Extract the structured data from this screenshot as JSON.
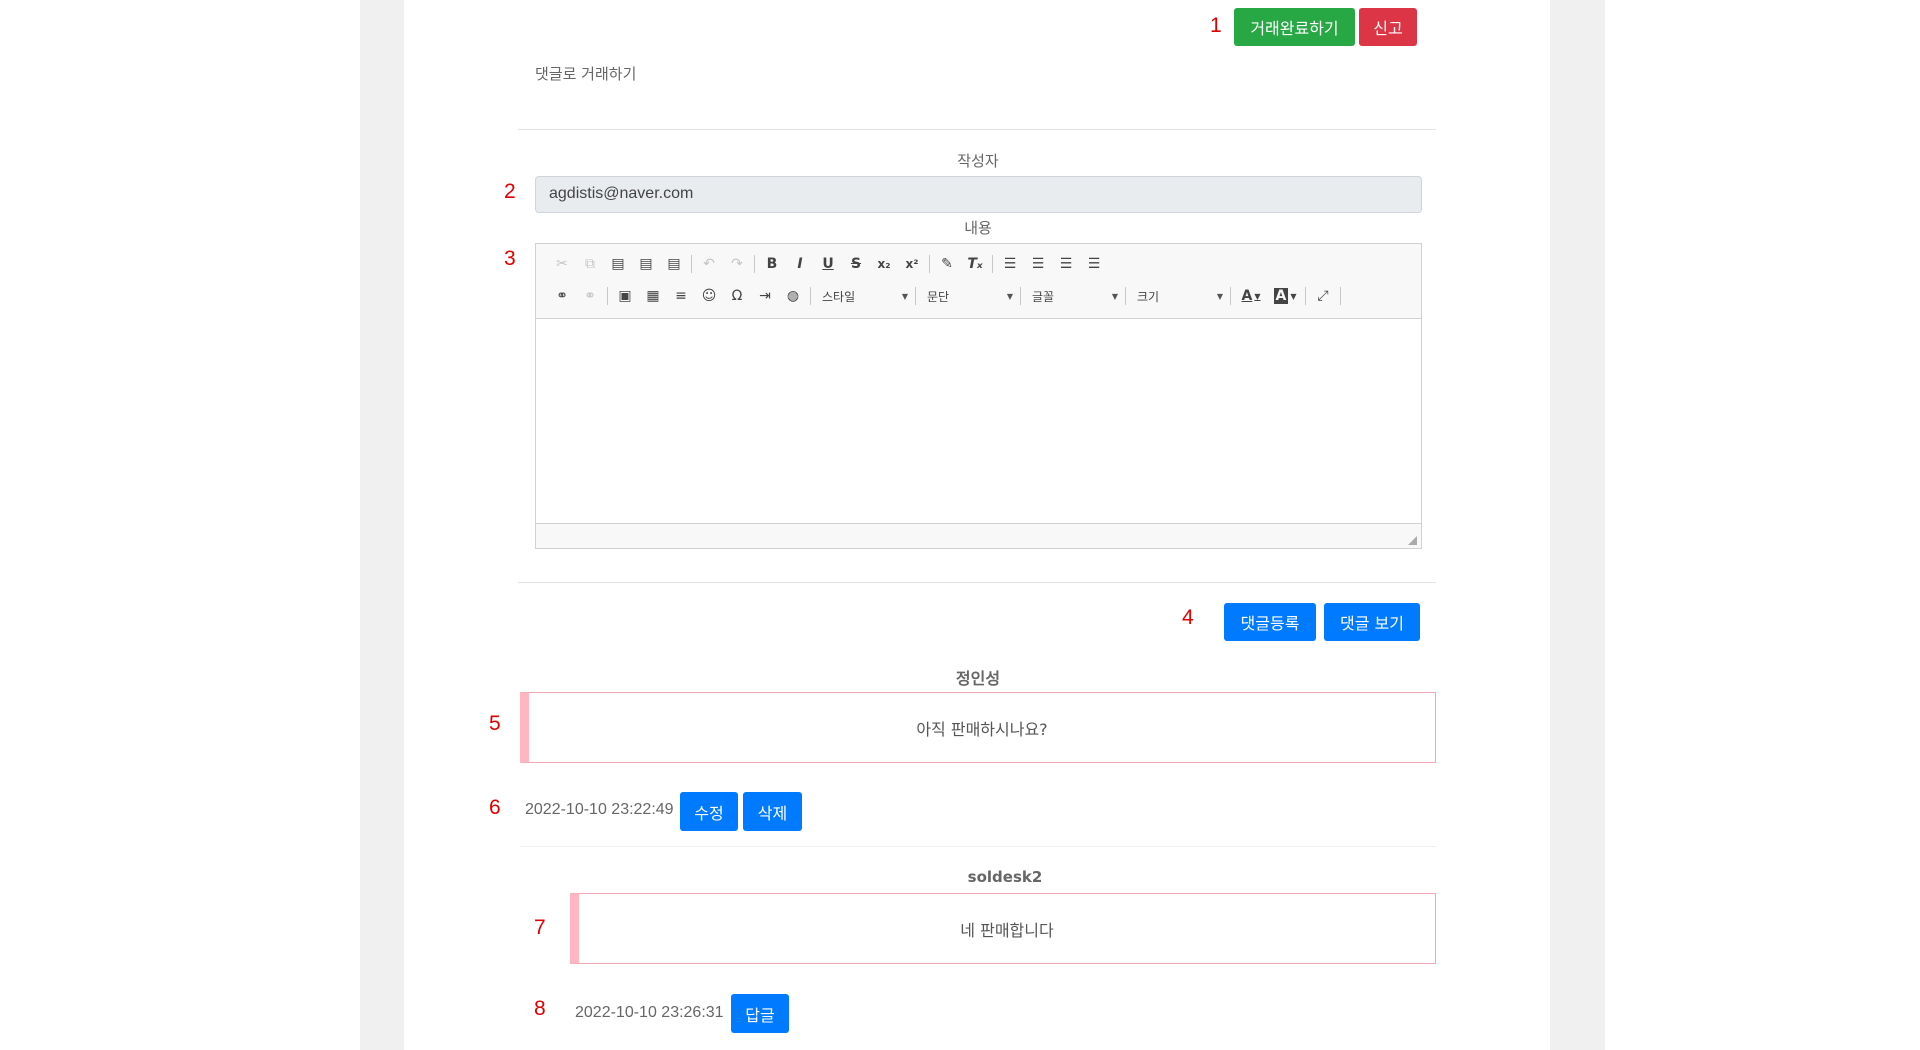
{
  "markers": [
    "1",
    "2",
    "3",
    "4",
    "5",
    "6",
    "7",
    "8"
  ],
  "header": {
    "complete_button": "거래완료하기",
    "report_button": "신고",
    "subtitle": "댓글로 거래하기"
  },
  "form": {
    "writer_label": "작성자",
    "writer_value": "agdistis@naver.com",
    "content_label": "내용",
    "submit_button": "댓글등록",
    "view_button": "댓글 보기"
  },
  "editor": {
    "toolbar_row1": [
      {
        "name": "cut-icon",
        "glyph": "✂",
        "disabled": true
      },
      {
        "name": "copy-icon",
        "glyph": "⧉",
        "disabled": true
      },
      {
        "name": "paste-icon",
        "glyph": "📋",
        "disabled": false
      },
      {
        "name": "paste-text-icon",
        "glyph": "📋",
        "disabled": false
      },
      {
        "name": "paste-word-icon",
        "glyph": "📋",
        "disabled": false
      },
      {
        "name": "undo-icon",
        "glyph": "↶",
        "disabled": true
      },
      {
        "name": "redo-icon",
        "glyph": "↷",
        "disabled": true
      },
      {
        "name": "bold-icon",
        "glyph": "B"
      },
      {
        "name": "italic-icon",
        "glyph": "I"
      },
      {
        "name": "underline-icon",
        "glyph": "U"
      },
      {
        "name": "strike-icon",
        "glyph": "S"
      },
      {
        "name": "subscript-icon",
        "glyph": "x₂"
      },
      {
        "name": "superscript-icon",
        "glyph": "x²"
      },
      {
        "name": "copy-format-icon",
        "glyph": "🖌"
      },
      {
        "name": "remove-format-icon",
        "glyph": "Tₓ"
      },
      {
        "name": "align-left-icon",
        "glyph": "≡"
      },
      {
        "name": "align-center-icon",
        "glyph": "≡"
      },
      {
        "name": "align-right-icon",
        "glyph": "≡"
      },
      {
        "name": "align-justify-icon",
        "glyph": "≣"
      }
    ],
    "toolbar_row2": [
      {
        "name": "link-icon",
        "glyph": "🔗"
      },
      {
        "name": "unlink-icon",
        "glyph": "⛓",
        "disabled": true
      },
      {
        "name": "image-icon",
        "glyph": "🖼"
      },
      {
        "name": "table-icon",
        "glyph": "▦"
      },
      {
        "name": "horizontal-rule-icon",
        "glyph": "☰"
      },
      {
        "name": "smiley-icon",
        "glyph": "☺"
      },
      {
        "name": "special-char-icon",
        "glyph": "Ω"
      },
      {
        "name": "page-break-icon",
        "glyph": "⇥"
      },
      {
        "name": "iframe-icon",
        "glyph": "🌐"
      }
    ],
    "combos": [
      "스타일",
      "문단",
      "글꼴",
      "크기"
    ],
    "text_color_glyph": "A",
    "bg_color_glyph": "A",
    "maximize_glyph": "⤢"
  },
  "comments": [
    {
      "author": "정인성",
      "text": "아직 판매하시나요?",
      "timestamp": "2022-10-10 23:22:49",
      "edit_button": "수정",
      "delete_button": "삭제"
    },
    {
      "author": "soldesk2",
      "text": "네 판매합니다",
      "timestamp": "2022-10-10 23:26:31",
      "reply_button": "답글"
    }
  ],
  "colors": {
    "green": "#28a745",
    "red": "#dc3545",
    "blue": "#007bff",
    "comment_border": "#ffb6c1",
    "marker": "#e00000"
  }
}
